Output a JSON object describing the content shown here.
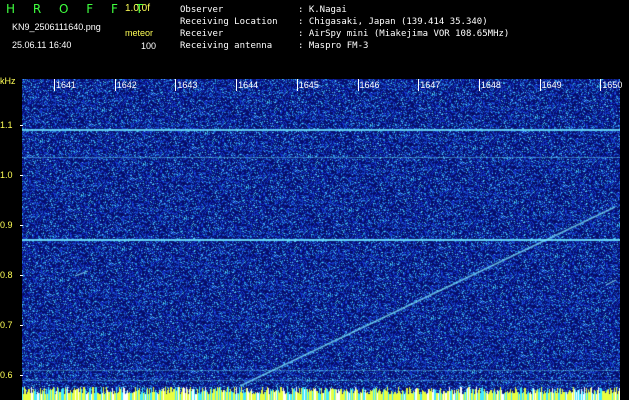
{
  "header": {
    "brand": "H R O F F T",
    "version": "1.0.0f",
    "filename": "KN9_2506111640.png",
    "mode": "meteor",
    "datetime": "25.06.11 16:40",
    "count": "100",
    "fields": [
      {
        "label": "Observer",
        "value": ": K.Nagai"
      },
      {
        "label": "Receiving Location",
        "value": ": Chigasaki, Japan (139.414 35.340)"
      },
      {
        "label": "Receiver",
        "value": ": AirSpy mini (Miakejima VOR 108.65MHz)"
      },
      {
        "label": "Receiving antenna",
        "value": ": Maspro FM-3"
      }
    ]
  },
  "axes": {
    "y_unit": "kHz",
    "y_ticks": [
      "1.1",
      "1.0",
      "0.9",
      "0.8",
      "0.7",
      "0.6"
    ],
    "x_ticks": [
      "1641",
      "1642",
      "1643",
      "1644",
      "1645",
      "1646",
      "1647",
      "1648",
      "1649",
      "1650"
    ]
  },
  "colors": {
    "background": "#000000",
    "noise_dark": "#08127a",
    "line": "#55d8ff",
    "brand": "#3fff3f",
    "axis_label": "#ffff55"
  }
}
